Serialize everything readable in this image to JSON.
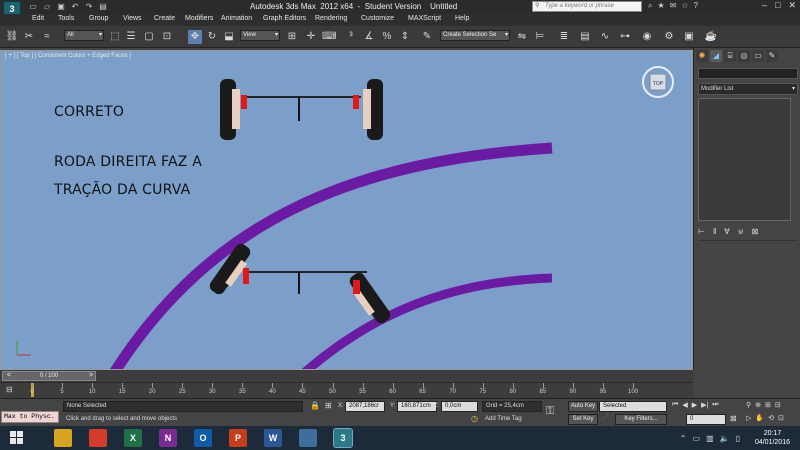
{
  "window": {
    "title": "Autodesk 3ds Max  2012 x64  -  Student Version    Untitled",
    "search_placeholder": "Type a keyword or phrase",
    "logo": "3ds-max-logo"
  },
  "menu": [
    "Edit",
    "Tools",
    "Group",
    "Views",
    "Create",
    "Modifiers",
    "Animation",
    "Graph Editors",
    "Rendering",
    "Customize",
    "MAXScript",
    "Help"
  ],
  "toolbar": {
    "filter_value": "All",
    "coord_system": "View",
    "selection_set_placeholder": "Create Selection Se"
  },
  "viewport": {
    "label": "[ + ] [ Top ] [ Consistent Colors + Edged Faces ]",
    "text_lines": [
      "CORRETO",
      "RODA DIREITA FAZ A",
      "TRAÇÃO DA CURVA"
    ],
    "viewcube_label": "TOP",
    "colors": {
      "background": "#7b9fc9",
      "track": "#6a1aa3",
      "wheel": "#1a1a1a",
      "hub": "#e8d0c0",
      "bracket": "#e01818"
    }
  },
  "command_panel": {
    "modifier_list": "Modifier List",
    "tabs": [
      "create-icon",
      "modify-icon",
      "hierarchy-icon",
      "motion-icon",
      "display-icon",
      "utilities-icon"
    ]
  },
  "timeline": {
    "frame_display": "0 / 100",
    "ticks": [
      "0",
      "5",
      "10",
      "15",
      "20",
      "25",
      "30",
      "35",
      "40",
      "45",
      "50",
      "55",
      "60",
      "65",
      "70",
      "75",
      "80",
      "85",
      "90",
      "95",
      "100"
    ]
  },
  "status": {
    "maxscript_label": "Max to Physc.",
    "selection": "None Selected",
    "prompt": "Click and drag to select and move objects",
    "x_label": "X:",
    "x_value": "2087,186cr",
    "y_label": "Y:",
    "y_value": "160,871cm",
    "z_label": "Z:",
    "z_value": "0,0cm",
    "grid": "Grid = 25,4cm",
    "add_time_tag": "Add Time Tag",
    "auto_key": "Auto Key",
    "set_key": "Set Key",
    "selected_dropdown": "Selected",
    "key_filters": "Key Filters...",
    "current_frame": "0"
  },
  "taskbar": {
    "apps": [
      {
        "name": "file-explorer-icon",
        "label": "",
        "color": "#d9a520"
      },
      {
        "name": "chrome-icon",
        "label": "",
        "color": "#d33c2b"
      },
      {
        "name": "excel-icon",
        "label": "X",
        "color": "#1e7145"
      },
      {
        "name": "onenote-icon",
        "label": "N",
        "color": "#7a2b8f"
      },
      {
        "name": "outlook-icon",
        "label": "O",
        "color": "#0f5ba7"
      },
      {
        "name": "powerpoint-icon",
        "label": "P",
        "color": "#c43e1c"
      },
      {
        "name": "word-icon",
        "label": "W",
        "color": "#2b5797"
      },
      {
        "name": "photos-icon",
        "label": "",
        "color": "#3d6e9e"
      },
      {
        "name": "3dsmax-icon",
        "label": "3",
        "color": "#2a7a85"
      }
    ],
    "time": "20:17",
    "date": "04/01/2016"
  }
}
